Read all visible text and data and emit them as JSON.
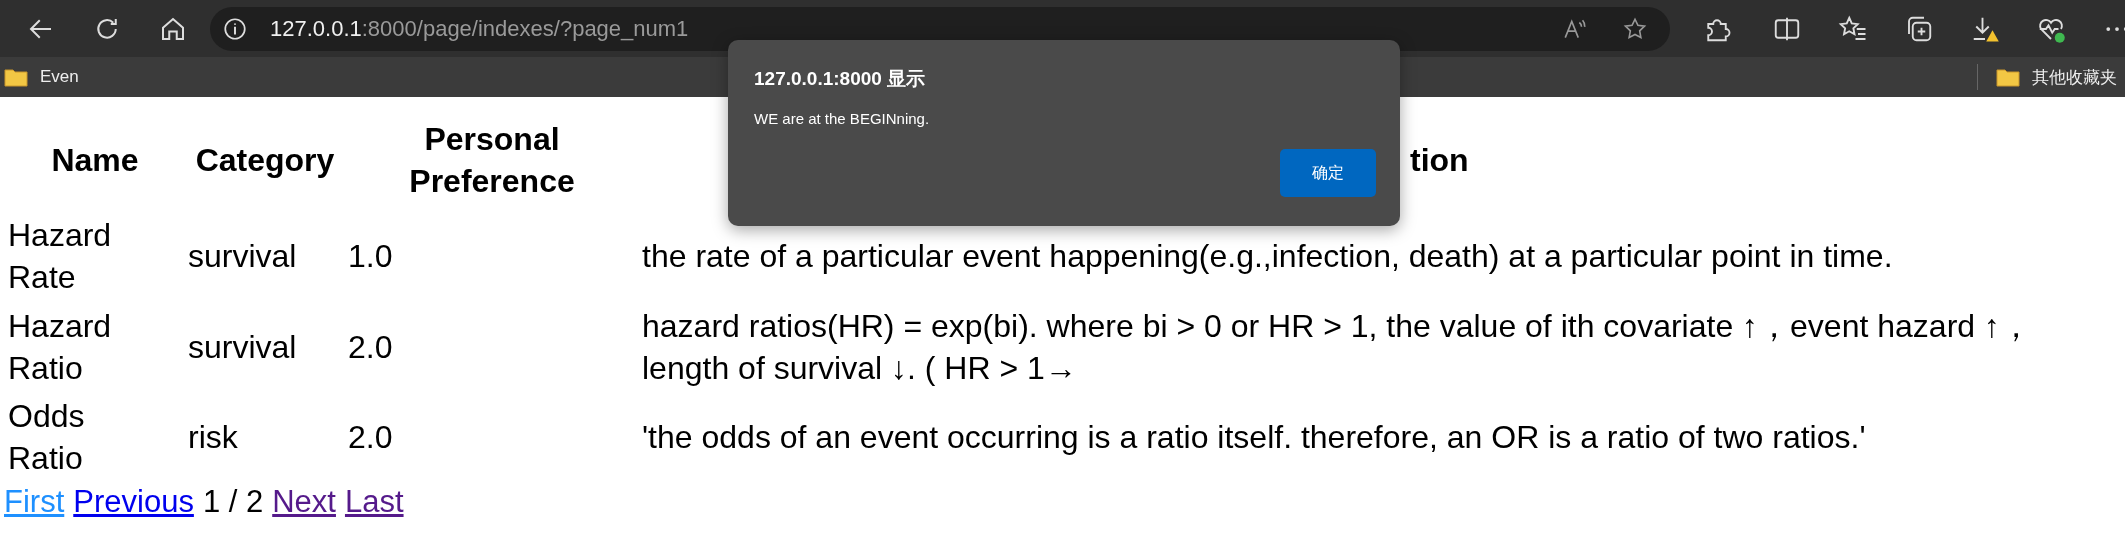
{
  "browser": {
    "address": {
      "host": "127.0.0.1",
      "path": ":8000/page/indexes/?page_num1"
    },
    "bookmarks": [
      {
        "label": "Even"
      }
    ],
    "other_bookmarks": "其他收藏夹"
  },
  "table": {
    "columns": [
      "Name",
      "Category",
      "Personal Preference",
      "tion"
    ],
    "rows": [
      {
        "name": "Hazard Rate",
        "category": "survival",
        "preference": "1.0",
        "description": "the rate of a particular event happening(e.g.,infection, death) at a particular point in time."
      },
      {
        "name": "Hazard Ratio",
        "category": "survival",
        "preference": "2.0",
        "description": "hazard ratios(HR) = exp(bi). where bi > 0 or HR > 1, the value of ith covariate ↑，event hazard ↑，length of survival ↓. ( HR > 1→"
      },
      {
        "name": "Odds Ratio",
        "category": "risk",
        "preference": "2.0",
        "description": "'the odds of an event occurring is a ratio itself. therefore, an OR is a ratio of two ratios.'"
      }
    ]
  },
  "pagination": {
    "links_before": [
      {
        "label": "First",
        "hovered": true,
        "visited": false
      },
      {
        "label": "Previous",
        "hovered": false,
        "visited": false
      }
    ],
    "status": "1 / 2",
    "links_after": [
      {
        "label": "Next",
        "hovered": false,
        "visited": true
      },
      {
        "label": "Last",
        "hovered": false,
        "visited": true
      }
    ]
  },
  "dialog": {
    "title": "127.0.0.1:8000 显示",
    "message": "WE are at the BEGINning.",
    "button": "确定"
  }
}
